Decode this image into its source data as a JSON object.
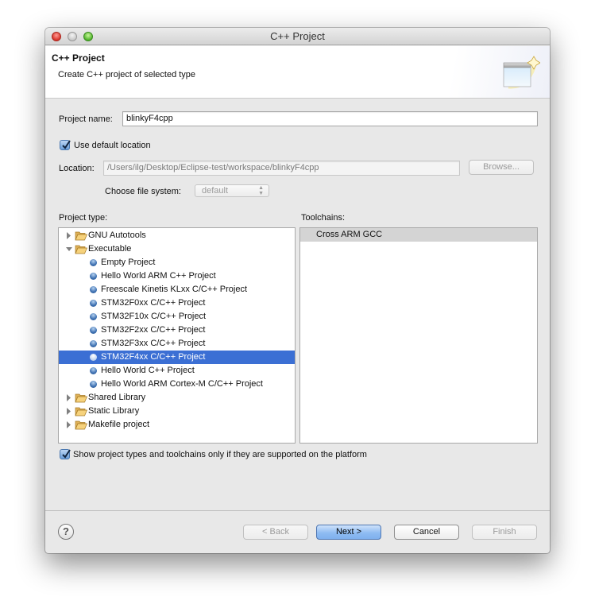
{
  "window": {
    "title": "C++ Project"
  },
  "banner": {
    "title": "C++ Project",
    "description": "Create C++ project of selected type",
    "icon": "new-project-wizard-icon"
  },
  "form": {
    "project_name_label": "Project name:",
    "project_name_value": "blinkyF4cpp",
    "use_default_location_label": "Use default location",
    "use_default_location_checked": true,
    "location_label": "Location:",
    "location_value": "/Users/ilg/Desktop/Eclipse-test/workspace/blinkyF4cpp",
    "browse_label": "Browse...",
    "file_system_label": "Choose file system:",
    "file_system_value": "default"
  },
  "project_type": {
    "label": "Project type:",
    "items": [
      {
        "label": "GNU Autotools",
        "kind": "folder",
        "expanded": false,
        "level": 0
      },
      {
        "label": "Executable",
        "kind": "folder",
        "expanded": true,
        "level": 0
      },
      {
        "label": "Empty Project",
        "kind": "item",
        "level": 1
      },
      {
        "label": "Hello World ARM C++ Project",
        "kind": "item",
        "level": 1
      },
      {
        "label": "Freescale Kinetis KLxx C/C++ Project",
        "kind": "item",
        "level": 1
      },
      {
        "label": "STM32F0xx C/C++ Project",
        "kind": "item",
        "level": 1
      },
      {
        "label": "STM32F10x C/C++ Project",
        "kind": "item",
        "level": 1
      },
      {
        "label": "STM32F2xx C/C++ Project",
        "kind": "item",
        "level": 1
      },
      {
        "label": "STM32F3xx C/C++ Project",
        "kind": "item",
        "level": 1
      },
      {
        "label": "STM32F4xx C/C++ Project",
        "kind": "item",
        "level": 1,
        "selected": true
      },
      {
        "label": "Hello World C++ Project",
        "kind": "item",
        "level": 1
      },
      {
        "label": "Hello World ARM Cortex-M C/C++ Project",
        "kind": "item",
        "level": 1
      },
      {
        "label": "Shared Library",
        "kind": "folder",
        "expanded": false,
        "level": 0
      },
      {
        "label": "Static Library",
        "kind": "folder",
        "expanded": false,
        "level": 0
      },
      {
        "label": "Makefile project",
        "kind": "folder",
        "expanded": false,
        "level": 0
      }
    ]
  },
  "toolchains": {
    "label": "Toolchains:",
    "items": [
      "Cross ARM GCC"
    ]
  },
  "filter": {
    "label": "Show project types and toolchains only if they are supported on the platform",
    "checked": true
  },
  "buttons": {
    "help": "?",
    "back": "< Back",
    "next": "Next >",
    "cancel": "Cancel",
    "finish": "Finish"
  },
  "colors": {
    "selection": "#3b6fd4",
    "default_button": "#8fbcf2"
  }
}
